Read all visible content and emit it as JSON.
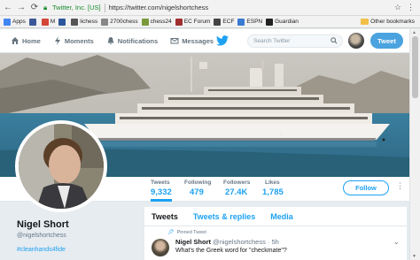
{
  "browser": {
    "secure_label": "Twitter, Inc. [US]",
    "url": "https://twitter.com/nigelshortchess",
    "bookmarks": [
      {
        "label": "Apps",
        "color": "#4285f4"
      },
      {
        "label": "",
        "color": "#3b5998"
      },
      {
        "label": "M",
        "color": "#d44638"
      },
      {
        "label": "",
        "color": "#2b579a"
      },
      {
        "label": "lichess",
        "color": "#555555"
      },
      {
        "label": "2700chess",
        "color": "#888888"
      },
      {
        "label": "chess24",
        "color": "#7a9a3a"
      },
      {
        "label": "EC Forum",
        "color": "#a03030"
      },
      {
        "label": "ECF",
        "color": "#444444"
      },
      {
        "label": "ESPN",
        "color": "#3a7ad0"
      },
      {
        "label": "Guardian",
        "color": "#222222"
      }
    ],
    "other_bookmarks": "Other bookmarks"
  },
  "twitter": {
    "nav": {
      "home": "Home",
      "moments": "Moments",
      "notifications": "Notifications",
      "messages": "Messages"
    },
    "search_placeholder": "Search Twitter",
    "tweet_button": "Tweet"
  },
  "profile": {
    "name": "Nigel Short",
    "handle": "@nigelshortchess",
    "hashtag": "#cleanhands4fide",
    "follow_button": "Follow",
    "stats": [
      {
        "label": "Tweets",
        "value": "9,332"
      },
      {
        "label": "Following",
        "value": "479"
      },
      {
        "label": "Followers",
        "value": "27.4K"
      },
      {
        "label": "Likes",
        "value": "1,785"
      }
    ]
  },
  "timeline": {
    "tabs": [
      "Tweets",
      "Tweets & replies",
      "Media"
    ],
    "pinned_label": "Pinned Tweet",
    "tweet": {
      "author": "Nigel Short",
      "handle_time": "@nigelshortchess · 5h",
      "text": "What's the Greek word for \"checkmate\"?"
    }
  }
}
